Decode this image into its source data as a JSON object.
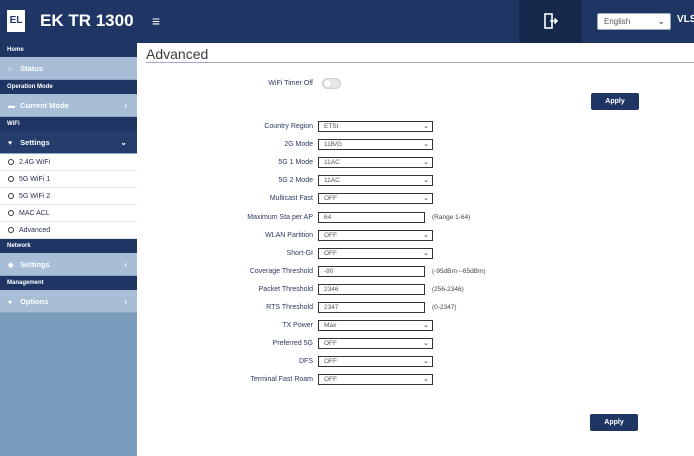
{
  "header": {
    "logo_text": "EL",
    "brand_name": "EK TR 1300",
    "menu_icon": "hamburger-icon",
    "logout_icon": "logout-icon",
    "language": "English",
    "user": "VLS"
  },
  "sidebar": {
    "home_header": "Home",
    "status_label": "Status",
    "operation_header": "Operation Mode",
    "current_mode_label": "Current Mode",
    "wifi_header": "WiFi",
    "wifi_settings_label": "Settings",
    "wifi_sub": [
      "2.4G WiFi",
      "5G WiFi 1",
      "5G WiFi 2",
      "MAC ACL",
      "Advanced"
    ],
    "network_header": "Network",
    "network_settings_label": "Settings",
    "management_header": "Management",
    "options_label": "Options"
  },
  "main": {
    "title": "Advanced",
    "wifi_timer_label": "WiFi Timer Off",
    "wifi_timer_on": false,
    "apply_label": "Apply",
    "fields": [
      {
        "label": "Country Region",
        "value": "ETSI",
        "type": "select",
        "hint": ""
      },
      {
        "label": "2G Mode",
        "value": "11B/G",
        "type": "select",
        "hint": ""
      },
      {
        "label": "5G 1 Mode",
        "value": "11AC",
        "type": "select",
        "hint": ""
      },
      {
        "label": "5G 2 Mode",
        "value": "11AC",
        "type": "select",
        "hint": ""
      },
      {
        "label": "Multicast Fast",
        "value": "OFF",
        "type": "select",
        "hint": ""
      },
      {
        "label": "Maximum Sta per AP",
        "value": "64",
        "type": "input",
        "hint": "(Range 1-64)"
      },
      {
        "label": "WLAN Partition",
        "value": "OFF",
        "type": "select",
        "hint": ""
      },
      {
        "label": "Short-GI",
        "value": "OFF",
        "type": "select",
        "hint": ""
      },
      {
        "label": "Coverage Threshold",
        "value": "-90",
        "type": "input",
        "hint": "(-95dBm~-65dBm)"
      },
      {
        "label": "Packet Threshold",
        "value": "2346",
        "type": "input",
        "hint": "(256-2346)"
      },
      {
        "label": "RTS Threshold",
        "value": "2347",
        "type": "input",
        "hint": "(0-2347)"
      },
      {
        "label": "TX Power",
        "value": "Max",
        "type": "select",
        "hint": ""
      },
      {
        "label": "Preferred 5G",
        "value": "OFF",
        "type": "select",
        "hint": ""
      },
      {
        "label": "DFS",
        "value": "OFF",
        "type": "select",
        "hint": ""
      },
      {
        "label": "Terminal Fast Roam",
        "value": "OFF",
        "type": "select",
        "hint": ""
      }
    ]
  }
}
